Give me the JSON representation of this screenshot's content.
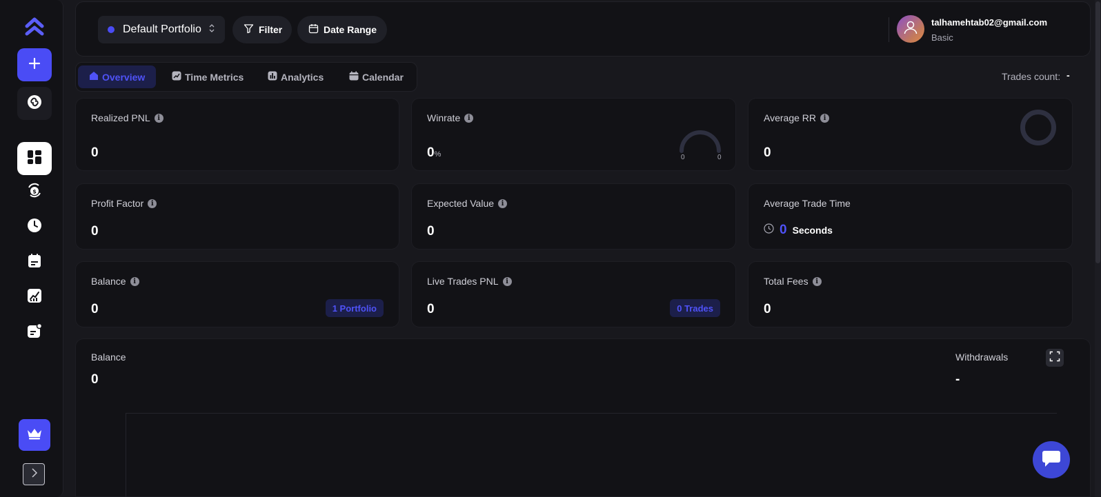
{
  "sidebar": {
    "logo_icon": "app-logo-icon",
    "items": [
      {
        "icon": "plus-icon"
      },
      {
        "icon": "link-icon"
      },
      {
        "icon": "dashboard-icon"
      },
      {
        "icon": "trades-cycle-icon"
      },
      {
        "icon": "clock-icon"
      },
      {
        "icon": "calendar-note-icon"
      },
      {
        "icon": "chart-growth-icon"
      },
      {
        "icon": "notes-icon"
      }
    ],
    "crown_icon": "crown-icon",
    "expand_icon": "chevron-right-icon"
  },
  "header": {
    "portfolio": "Default Portfolio",
    "filter_label": "Filter",
    "date_range_label": "Date Range",
    "user_email": "talhamehtab02@gmail.com",
    "user_plan": "Basic"
  },
  "tabs": [
    {
      "label": "Overview",
      "active": true
    },
    {
      "label": "Time Metrics"
    },
    {
      "label": "Analytics"
    },
    {
      "label": "Calendar"
    }
  ],
  "trades_count": {
    "label": "Trades count:",
    "value": "-"
  },
  "cards": {
    "realized_pnl": {
      "label": "Realized PNL",
      "value": "0"
    },
    "winrate": {
      "label": "Winrate",
      "value": "0",
      "unit": "%",
      "gauge_min": "0",
      "gauge_max": "0"
    },
    "average_rr": {
      "label": "Average RR",
      "value": "0"
    },
    "profit_factor": {
      "label": "Profit Factor",
      "value": "0"
    },
    "expected_value": {
      "label": "Expected Value",
      "value": "0"
    },
    "average_trade_time": {
      "label": "Average Trade Time",
      "value": "0",
      "unit": "Seconds"
    },
    "balance": {
      "label": "Balance",
      "value": "0",
      "badge": "1 Portfolio"
    },
    "live_trades_pnl": {
      "label": "Live Trades PNL",
      "value": "0",
      "badge": "0 Trades"
    },
    "total_fees": {
      "label": "Total Fees",
      "value": "0"
    }
  },
  "balance_chart": {
    "label": "Balance",
    "value": "0",
    "withdrawals_label": "Withdrawals",
    "withdrawals_value": "-"
  },
  "colors": {
    "accent": "#4a4cf5",
    "background": "#18181d",
    "card": "#121216"
  }
}
